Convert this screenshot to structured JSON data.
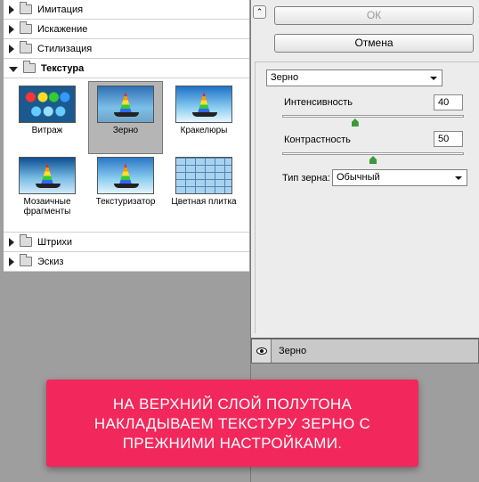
{
  "categories_top": [
    {
      "label": "Имитация"
    },
    {
      "label": "Искажение"
    },
    {
      "label": "Стилизация"
    }
  ],
  "texture": {
    "label": "Текстура",
    "thumbs": [
      {
        "label": "Витраж"
      },
      {
        "label": "Зерно"
      },
      {
        "label": "Кракелюры"
      },
      {
        "label": "Мозаичные фрагменты"
      },
      {
        "label": "Текстуризатор"
      },
      {
        "label": "Цветная плитка"
      }
    ]
  },
  "categories_bottom": [
    {
      "label": "Штрихи"
    },
    {
      "label": "Эскиз"
    }
  ],
  "buttons": {
    "ok": "ОК",
    "cancel": "Отмена"
  },
  "settings": {
    "filter": "Зерно",
    "intensity": {
      "label": "Интенсивность",
      "value": "40",
      "fraction": 0.4
    },
    "contrast": {
      "label": "Контрастность",
      "value": "50",
      "fraction": 0.5
    },
    "grain_type": {
      "label": "Тип зерна:",
      "value": "Обычный"
    }
  },
  "layer": {
    "name": "Зерно"
  },
  "banner": {
    "lines": [
      "НА ВЕРХНИЙ СЛОЙ ПОЛУТОНА",
      "НАКЛАДЫВАЕМ ТЕКСТУРУ ЗЕРНО С",
      "ПРЕЖНИМИ НАСТРОЙКАМИ."
    ],
    "color": "#f2285c"
  },
  "colors": {
    "slider_knob": "#3a9a3a",
    "panel": "#ececec",
    "canvas_gray": "#9e9e9e"
  }
}
